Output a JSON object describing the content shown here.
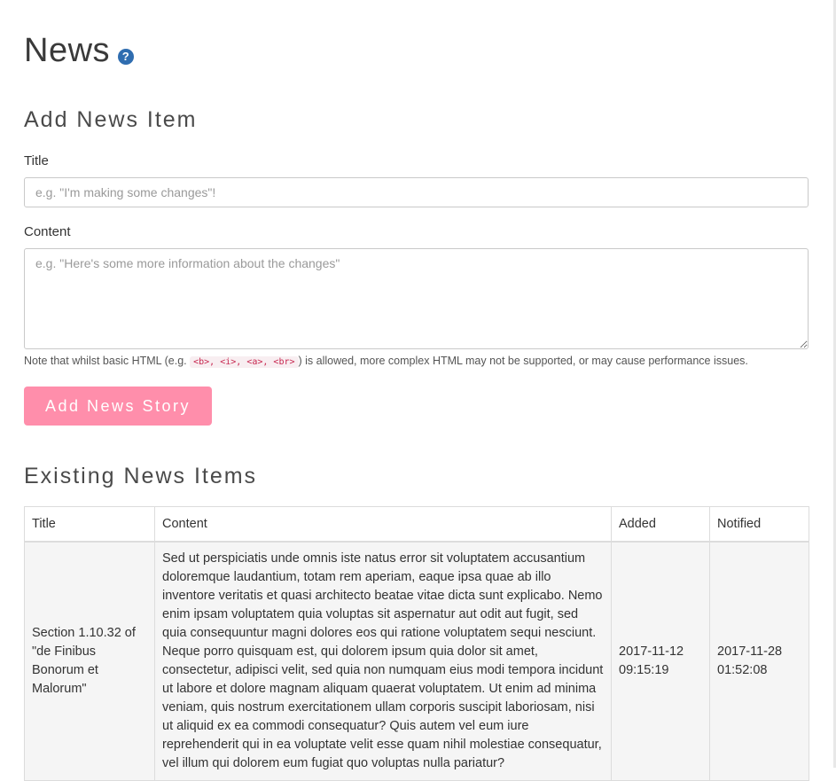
{
  "page": {
    "title": "News",
    "help_icon_glyph": "?"
  },
  "add_section": {
    "heading": "Add News Item",
    "title_label": "Title",
    "title_placeholder": "e.g. \"I'm making some changes\"!",
    "content_label": "Content",
    "content_placeholder": "e.g. \"Here's some more information about the changes\"",
    "help_prefix": "Note that whilst basic HTML (e.g. ",
    "help_code": "<b>, <i>, <a>, <br>",
    "help_suffix": ") is allowed, more complex HTML may not be supported, or may cause performance issues.",
    "submit_label": "Add News Story",
    "submit_color": "#ff8eab"
  },
  "existing_section": {
    "heading": "Existing News Items",
    "columns": [
      "Title",
      "Content",
      "Added",
      "Notified"
    ],
    "rows": [
      {
        "title": "Section 1.10.32 of \"de Finibus Bonorum et Malorum\"",
        "content": "Sed ut perspiciatis unde omnis iste natus error sit voluptatem accusantium doloremque laudantium, totam rem aperiam, eaque ipsa quae ab illo inventore veritatis et quasi architecto beatae vitae dicta sunt explicabo. Nemo enim ipsam voluptatem quia voluptas sit aspernatur aut odit aut fugit, sed quia consequuntur magni dolores eos qui ratione voluptatem sequi nesciunt. Neque porro quisquam est, qui dolorem ipsum quia dolor sit amet, consectetur, adipisci velit, sed quia non numquam eius modi tempora incidunt ut labore et dolore magnam aliquam quaerat voluptatem. Ut enim ad minima veniam, quis nostrum exercitationem ullam corporis suscipit laboriosam, nisi ut aliquid ex ea commodi consequatur? Quis autem vel eum iure reprehenderit qui in ea voluptate velit esse quam nihil molestiae consequatur, vel illum qui dolorem eum fugiat quo voluptas nulla pariatur?",
        "added": "2017-11-12 09:15:19",
        "notified": "2017-11-28 01:52:08"
      }
    ]
  }
}
